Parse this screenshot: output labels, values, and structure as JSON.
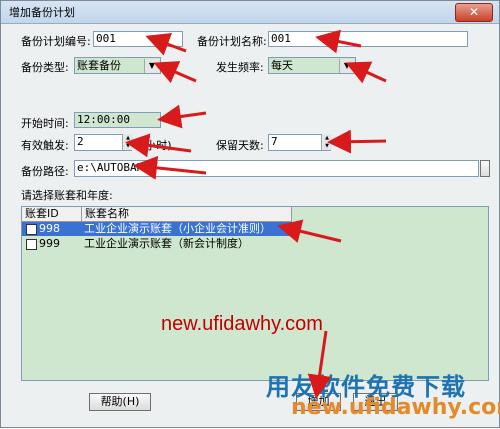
{
  "window": {
    "title": "增加备份计划",
    "close_symbol": "✕"
  },
  "form": {
    "plan_no_label": "备份计划编号:",
    "plan_no_value": "001",
    "plan_name_label": "备份计划名称:",
    "plan_name_value": "001",
    "backup_type_label": "备份类型:",
    "backup_type_value": "账套备份",
    "frequency_label": "发生频率:",
    "frequency_value": "每天",
    "start_time_label": "开始时间:",
    "start_time_value": "12:00:00",
    "trigger_label": "有效触发:",
    "trigger_value": "2",
    "trigger_unit": "(小时)",
    "retain_label": "保留天数:",
    "retain_value": "7",
    "path_label": "备份路径:",
    "path_value": "e:\\AUTOBAK\\"
  },
  "accounts": {
    "section_label": "请选择账套和年度:",
    "columns": [
      "账套ID",
      "账套名称"
    ],
    "rows": [
      {
        "id": "998",
        "name": "工业企业演示账套（小企业会计准则）",
        "checked": true,
        "selected": true
      },
      {
        "id": "999",
        "name": "工业企业演示账套（新会计制度）",
        "checked": false,
        "selected": false
      }
    ]
  },
  "buttons": {
    "help": "帮助(H)",
    "add": "增加",
    "exit": "退出"
  },
  "watermark": {
    "url_text": "new.ufidawhy.com",
    "brand_text": "用友软件免费下载",
    "url_text_2": "new.ufidawhy.com"
  },
  "icons": {
    "dropdown": "chevron-down-icon",
    "annotation_arrow": "red-arrow-icon"
  },
  "colors": {
    "accent_red": "#d91a1a",
    "field_green": "#cfe6cf",
    "selection_blue": "#3a72d4"
  }
}
